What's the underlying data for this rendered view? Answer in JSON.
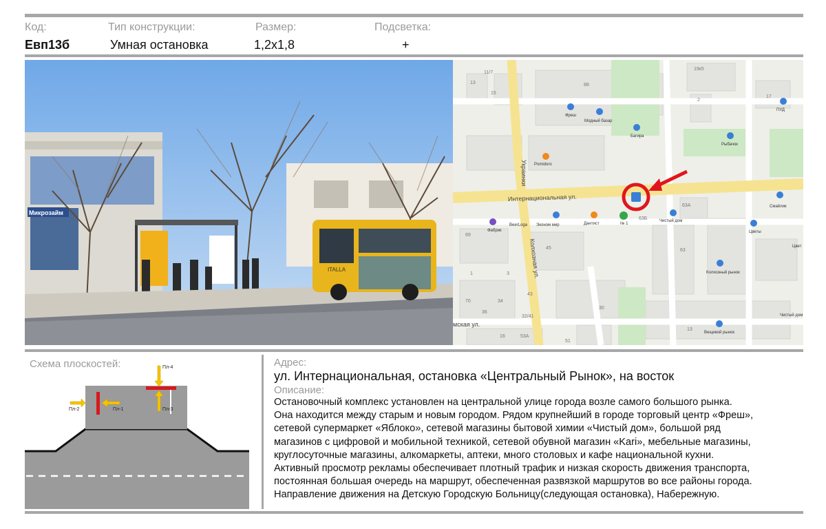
{
  "header": {
    "code_label": "Код:",
    "code_value": "Евп13б",
    "type_label": "Тип конструкции:",
    "type_value": "Умная остановка",
    "size_label": "Размер:",
    "size_value": "1,2x1,8",
    "light_label": "Подсветка:",
    "light_value": "+"
  },
  "photo": {
    "stop_sign": "Микрозайм",
    "bus_label": "ITALLA"
  },
  "map": {
    "streets": {
      "internatsionalnaya": "Интернациональная ул.",
      "kolkhoznaya": "Колхозная ул.",
      "ukrainskaya": "Украинки",
      "bottom_left": "мская ул."
    },
    "pois": {
      "fresh": "Фреш",
      "modny_bazar": "Модный базар",
      "bagira": "Багира",
      "pomidoro": "Pomidoro",
      "rybachok": "Рыбачок",
      "smile": "Смайлик",
      "pud": "ПУД",
      "beerloga": "BeerLoga",
      "fabrika": "Фабрик",
      "ekonom": "Эконом мир",
      "dantist": "Дантист",
      "apteka": "№ 1",
      "chisty_dom": "Чистый дом",
      "tsvety": "Цветы",
      "kolkhozny_rynok": "Колхозный рынок",
      "veshchevoy_rynok": "Вещевой рынок",
      "chisty_dom2": "Чистый дом",
      "tsvety2": "Цвет"
    },
    "houses": [
      "11/7",
      "13",
      "15",
      "88",
      "19к5",
      "2",
      "17",
      "63А",
      "63Б",
      "69",
      "45",
      "1",
      "3",
      "43",
      "63",
      "70",
      "36",
      "34",
      "32/41",
      "30",
      "16",
      "53А",
      "51",
      "13"
    ]
  },
  "scheme": {
    "title": "Схема плоскостей:",
    "planes": [
      "Пл-1",
      "Пл-2",
      "Пл-3",
      "Пл-4"
    ]
  },
  "address": {
    "label": "Адрес:",
    "value": "ул. Интернациональная, остановка «Центральный Рынок», на восток"
  },
  "description": {
    "label": "Описание:",
    "lines": [
      "Остановочный комплекс установлен на центральной улице города возле самого большого рынка.",
      "Она находится между старым и новым городом. Рядом крупнейший в городе торговый центр «Фреш»,",
      "сетевой супермаркет  «Яблоко», сетевой магазины бытовой химии «Чистый дом», большой ряд",
      "магазинов с цифровой и мобильной техникой, сетевой обувной магазин «Kari», мебельные магазины,",
      "круглосуточные магазины, алкомаркеты, аптеки, много столовых и кафе национальной кухни.",
      "Активный просмотр рекламы обеспечивает плотный трафик и низкая скорость движения транспорта,",
      "постоянная большая очередь на маршрут, обеспеченная развязкой маршрутов во все районы города.",
      "Направление движения на Детскую Городскую Больницу(следующая остановка), Набережную."
    ]
  },
  "colors": {
    "rule": "#a7a7a7",
    "label": "#9a9a9a",
    "marker_red": "#e0161c",
    "arrow_yellow": "#f5c400",
    "plane_red": "#d7191f",
    "road": "#9b9b9b",
    "bus": "#e9b51c"
  },
  "icons": [
    "map-marker-icon",
    "red-arrow-icon",
    "bus-stop-icon",
    "shop-icon",
    "pharmacy-icon"
  ]
}
